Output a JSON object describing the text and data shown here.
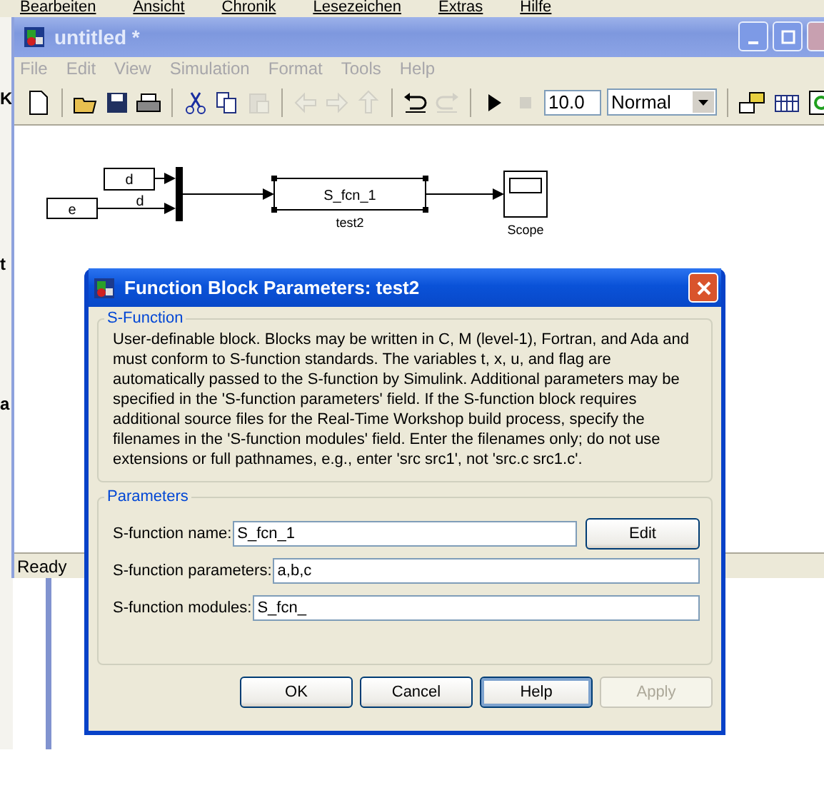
{
  "browser_menu": [
    "Bearbeiten",
    "Ansicht",
    "Chronik",
    "Lesezeichen",
    "Extras",
    "Hilfe"
  ],
  "side_fragments": [
    "K",
    "t",
    "a"
  ],
  "model_window": {
    "title": "untitled *",
    "active": false,
    "menu": [
      {
        "label": "File",
        "disabled": true
      },
      {
        "label": "Edit",
        "disabled": true
      },
      {
        "label": "View",
        "disabled": true
      },
      {
        "label": "Simulation",
        "disabled": true
      },
      {
        "label": "Format",
        "disabled": true
      },
      {
        "label": "Tools",
        "disabled": true
      },
      {
        "label": "Help",
        "disabled": true
      }
    ],
    "toolbar": [
      {
        "kind": "new",
        "disabled": false
      },
      {
        "kind": "sep"
      },
      {
        "kind": "open",
        "disabled": false
      },
      {
        "kind": "save",
        "disabled": false
      },
      {
        "kind": "print",
        "disabled": false
      },
      {
        "kind": "sep"
      },
      {
        "kind": "cut",
        "disabled": false
      },
      {
        "kind": "copy",
        "disabled": false
      },
      {
        "kind": "paste",
        "disabled": true
      },
      {
        "kind": "sep"
      },
      {
        "kind": "back",
        "disabled": true
      },
      {
        "kind": "forward",
        "disabled": true
      },
      {
        "kind": "up",
        "disabled": true
      },
      {
        "kind": "sep"
      },
      {
        "kind": "undo",
        "disabled": false
      },
      {
        "kind": "redo",
        "disabled": true
      },
      {
        "kind": "sep"
      },
      {
        "kind": "play",
        "disabled": false
      },
      {
        "kind": "stop",
        "disabled": true
      }
    ],
    "stop_time": "10.0",
    "mode": "Normal",
    "toolbar_end": [
      {
        "kind": "library",
        "disabled": false
      },
      {
        "kind": "grid",
        "disabled": false
      },
      {
        "kind": "refresh",
        "disabled": false
      }
    ],
    "blocks": [
      {
        "kind": "constant",
        "label": "d"
      },
      {
        "kind": "constant",
        "label": "e"
      },
      {
        "kind": "mux"
      },
      {
        "kind": "sfunction",
        "label": "S_fcn_1",
        "caption": "test2",
        "selected": true
      },
      {
        "kind": "scope",
        "caption": "Scope"
      }
    ],
    "signal_label": "d",
    "status": "Ready"
  },
  "dialog": {
    "title": "Function Block Parameters: test2",
    "active": true,
    "description_group": {
      "title": "S-Function",
      "text": "User-definable block.  Blocks may be written in C, M (level-1), Fortran, and Ada and must conform to S-function standards.  The variables t, x, u, and flag are automatically passed to the S-function by Simulink.  Additional parameters may be specified in the 'S-function parameters' field. If the S-function block requires additional source files for the Real-Time Workshop build process, specify the filenames in the 'S-function modules' field. Enter the filenames only; do not use extensions or full pathnames, e.g., enter 'src src1', not 'src.c src1.c'."
    },
    "parameters_group": {
      "title": "Parameters",
      "fields": [
        {
          "label": "S-function name:",
          "value": "S_fcn_1",
          "button": "Edit"
        },
        {
          "label": "S-function parameters:",
          "value": "a,b,c"
        },
        {
          "label": "S-function modules:",
          "value": "S_fcn_"
        }
      ]
    },
    "buttons": [
      {
        "label": "OK",
        "disabled": false,
        "focused": false
      },
      {
        "label": "Cancel",
        "disabled": false,
        "focused": false
      },
      {
        "label": "Help",
        "disabled": false,
        "focused": true
      },
      {
        "label": "Apply",
        "disabled": true,
        "focused": false
      }
    ]
  }
}
